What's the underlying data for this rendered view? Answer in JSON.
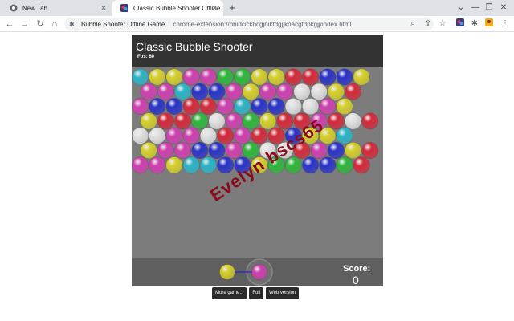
{
  "browser": {
    "tabs": [
      {
        "label": "New Tab",
        "icon": "chrome-icon"
      },
      {
        "label": "Classic Bubble Shooter Offline",
        "icon": "bubble-shooter-favicon"
      }
    ],
    "omnibox": {
      "site": "Bubble Shooter Offline Game",
      "url": "chrome-extension://phidcickhcgjnikfdgjjkoacgfdpkgjj/index.html"
    }
  },
  "game": {
    "title": "Classic Bubble Shooter",
    "fps_label": "Fps: 60",
    "watermark": "Evelyn bscs65",
    "score_label": "Score:",
    "score_value": "0",
    "colors": {
      "c": "#2bb5c7",
      "y": "#d6d02a",
      "m": "#d03fb0",
      "r": "#d42a3a",
      "g": "#2db83a",
      "b": "#2a33c8",
      "w": "#e2e2e2"
    },
    "rows": [
      "cyymmggyyrrbby",
      "mmcbbmymmwwyr",
      "mbbrrmcbbwwmy",
      "yrrgwmgyrrmrwr",
      "wwmmwrmrrbyyc",
      "ymmbbmgwwrmbyr",
      "mmyccbbyggbbgr"
    ],
    "current_bubble": "y",
    "next_bubble": "m"
  },
  "buttons": {
    "more_games": "More game...",
    "full": "Full",
    "web_version": "Web version"
  }
}
